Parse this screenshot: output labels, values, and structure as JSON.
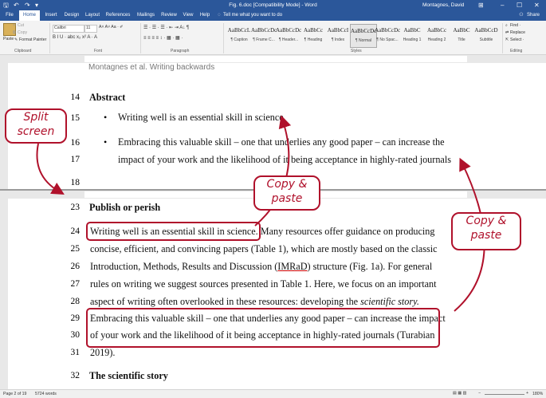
{
  "titlebar": {
    "title": "Fig. 6.doc [Compatibility Mode] - Word",
    "user": "Montagnes, David",
    "save_glyph": "🖫",
    "undo_glyph": "↶",
    "redo_glyph": "↷",
    "qa_more_glyph": "▾",
    "layout_glyph": "⊞",
    "min_glyph": "–",
    "max_glyph": "☐",
    "close_glyph": "✕"
  },
  "tabs": {
    "file": "File",
    "home": "Home",
    "insert": "Insert",
    "design": "Design",
    "layout": "Layout",
    "references": "References",
    "mailings": "Mailings",
    "review": "Review",
    "view": "View",
    "help": "Help",
    "tell": "Tell me what you want to do",
    "share": "Share"
  },
  "ribbon": {
    "cut": "Cut",
    "copy": "Copy",
    "paste": "Paste",
    "format_painter": "Format Painter",
    "font_name": "Calibri",
    "font_size": "11",
    "font_row2": "B  I  U  ·  abc  x₂  x²   A  ·  A",
    "para_row1": "☰ · ☰ · ☰ ·   ⇤  ⇥   A↓  ¶",
    "para_row2": "≡  ≡  ≡  ≡   ↕ ·   ▦ ·  ▦ ·",
    "styles": [
      {
        "sample": "AaBbCcL",
        "name": "¶ Caption"
      },
      {
        "sample": "AaBbCcDc",
        "name": "¶ Frame C..."
      },
      {
        "sample": "AaBbCcDc",
        "name": "¶ Header..."
      },
      {
        "sample": "AaBbCc",
        "name": "¶ Heading"
      },
      {
        "sample": "AaBbCcI",
        "name": "¶ Index"
      },
      {
        "sample": "AaBbCcDc",
        "name": "¶ Normal"
      },
      {
        "sample": "AaBbCcDc",
        "name": "¶ No Spac..."
      },
      {
        "sample": "AaBbC",
        "name": "Heading 1"
      },
      {
        "sample": "AaBbCc",
        "name": "Heading 2"
      },
      {
        "sample": "AaBbC",
        "name": "Title"
      },
      {
        "sample": "AaBbCcD",
        "name": "Subtitle"
      }
    ],
    "find": "Find ·",
    "replace": "Replace",
    "select": "Select ·",
    "groups": {
      "clipboard": "Clipboard",
      "font": "Font",
      "paragraph": "Paragraph",
      "styles": "Styles",
      "editing": "Editing"
    }
  },
  "doc_top": {
    "header_text": "Montagnes et al. Writing backwards",
    "lines": [
      {
        "num": "14",
        "text": "Abstract"
      },
      {
        "num": "15",
        "text": "Writing well is an essential skill in science"
      },
      {
        "num": "16",
        "text": "Embracing this valuable skill – one that underlies any good paper – can increase the"
      },
      {
        "num": "17",
        "text": "impact of your work and the likelihood of it being acceptance in highly-rated journals"
      },
      {
        "num": "18",
        "text": ""
      }
    ]
  },
  "doc_bottom": {
    "lines": [
      {
        "num": "23",
        "text": "Publish or perish"
      },
      {
        "num": "24",
        "text": "Writing well is an essential skill in science.  Many resources offer guidance on producing"
      },
      {
        "num": "25",
        "text": "concise, efficient, and convincing papers (Table 1), which are mostly based on the classic"
      },
      {
        "num": "26a",
        "text": "Introduction, Methods, Results and Discussion ("
      },
      {
        "num": "26b",
        "text": "IMRaD"
      },
      {
        "num": "26c",
        "text": ") structure (Fig. 1a).  For general"
      },
      {
        "num": "26",
        "text": ""
      },
      {
        "num": "27",
        "text": "rules on writing we suggest sources presented in Table 1.  Here, we focus on an important"
      },
      {
        "num": "28a",
        "text": "aspect of writing often overlooked in these resources: developing the "
      },
      {
        "num": "28b",
        "text": "scientific story."
      },
      {
        "num": "28",
        "text": ""
      },
      {
        "num": "29",
        "text": "Embracing this valuable skill – one that underlies any good paper – can increase the impact"
      },
      {
        "num": "30",
        "text": "of your work and the likelihood of it being acceptance in highly-rated journals (Turabian"
      },
      {
        "num": "31",
        "text": "2019)."
      },
      {
        "num": "32",
        "text": "The scientific story"
      }
    ]
  },
  "callouts": {
    "split": "Split\nscreen",
    "copy1": "Copy &\npaste",
    "copy2": "Copy &\npaste"
  },
  "status": {
    "page": "Page 2 of 19",
    "words": "5724 words",
    "zoom": "180%",
    "zoom_minus": "−",
    "zoom_plus": "+"
  },
  "colors": {
    "word_blue": "#2b579a",
    "annotation_red": "#b0112b"
  }
}
